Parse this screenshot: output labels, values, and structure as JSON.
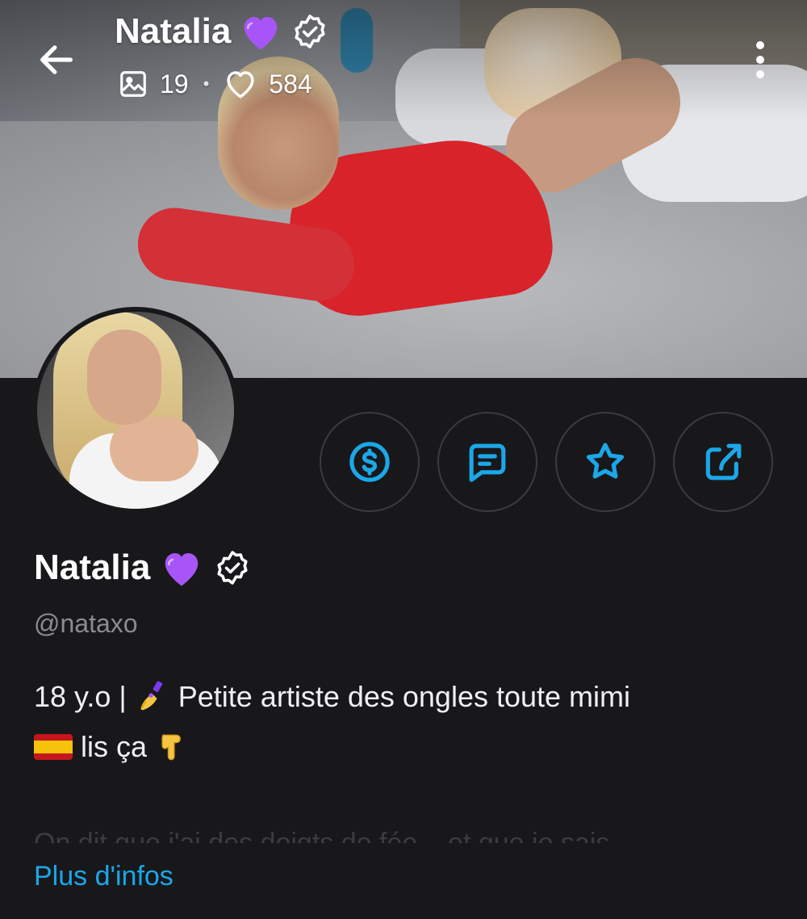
{
  "header": {
    "name": "Natalia",
    "media_count": "19",
    "likes_count": "584"
  },
  "profile": {
    "name": "Natalia",
    "handle": "@nataxo",
    "bio_line1_prefix": "18 y.o |",
    "bio_line1_text": "Petite artiste des ongles toute mimi",
    "bio_line2_text": "lis ça",
    "faded_text": "On dit que j'ai des doigts de fée... et que je sais",
    "more_link": "Plus d'infos"
  },
  "actions": [
    {
      "name": "tip",
      "icon": "dollar-circle-icon"
    },
    {
      "name": "message",
      "icon": "message-icon"
    },
    {
      "name": "favorite",
      "icon": "star-icon"
    },
    {
      "name": "share",
      "icon": "share-icon"
    }
  ],
  "colors": {
    "background": "#18181b",
    "accent": "#1ba7e8",
    "heart_purple": "#a855f7",
    "handle_gray": "#8b8b92"
  }
}
